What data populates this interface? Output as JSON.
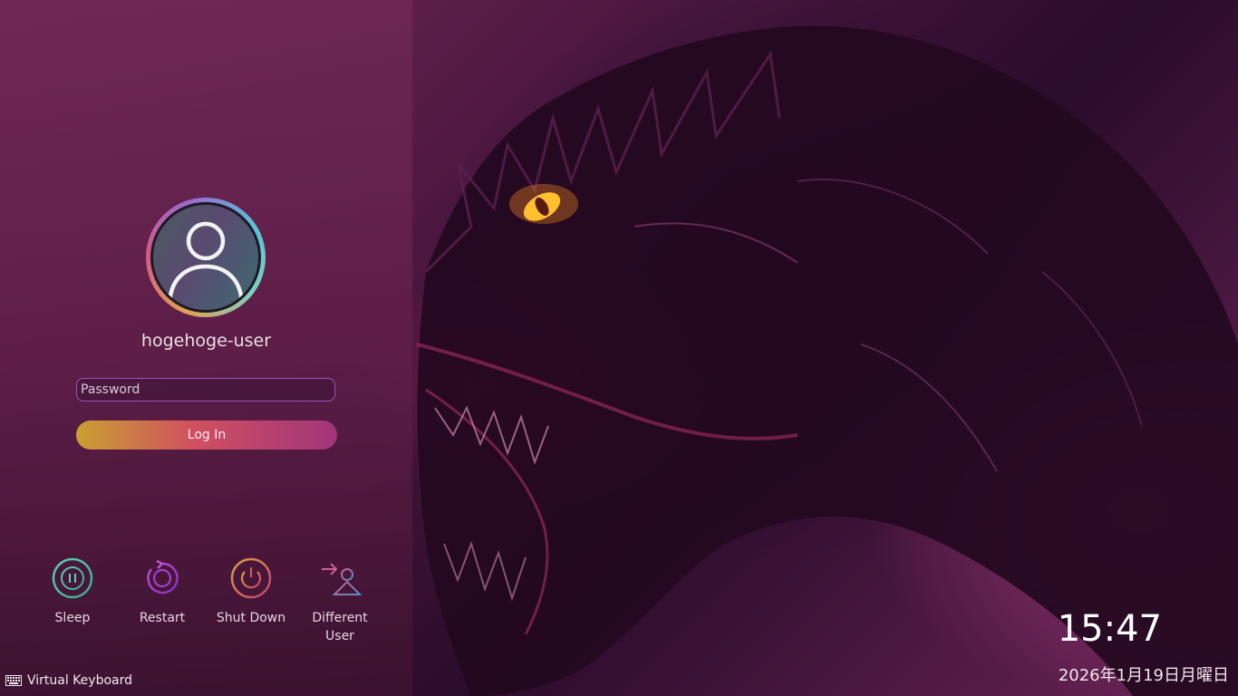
{
  "login": {
    "username": "hogehoge-user",
    "password_placeholder": "Password",
    "login_label": "Log In"
  },
  "actions": [
    {
      "label": "Sleep",
      "icon": "sleep-icon"
    },
    {
      "label": "Restart",
      "icon": "restart-icon"
    },
    {
      "label": "Shut Down",
      "icon": "power-icon"
    },
    {
      "label": "Different\nUser",
      "icon": "switch-user-icon"
    }
  ],
  "footer": {
    "virtual_keyboard": "Virtual Keyboard"
  },
  "clock": {
    "time": "15:47",
    "date": "2026年1月19日月曜日"
  },
  "colors": {
    "panel": "#6e2855",
    "login_gradient_start": "#c9a030",
    "login_gradient_end": "#a0357a",
    "input_border": "#a050c0"
  }
}
